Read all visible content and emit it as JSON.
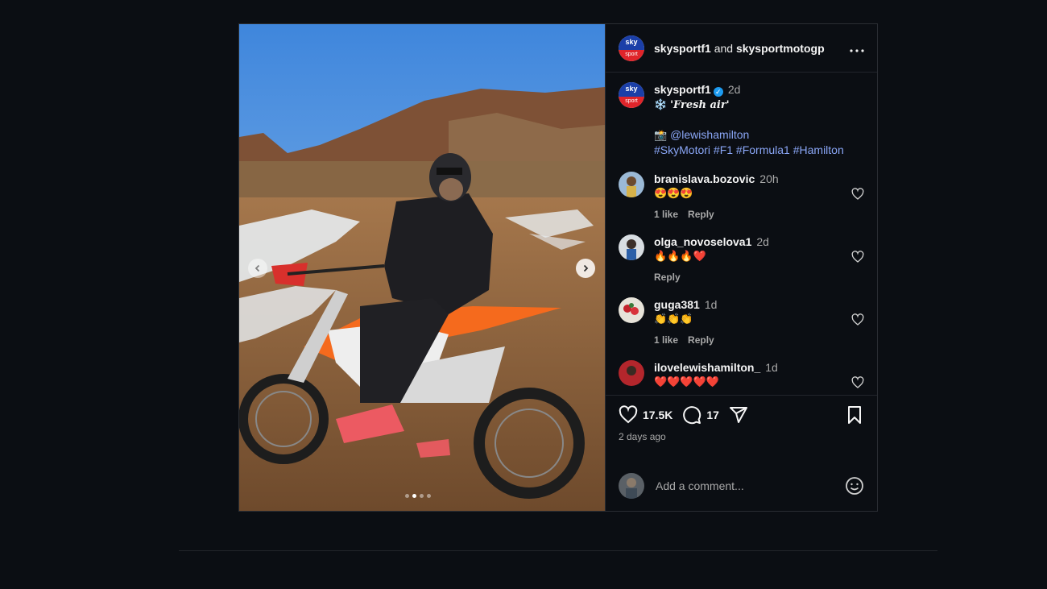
{
  "header": {
    "user1": "skysportf1",
    "and": "and",
    "user2": "skysportmotogp",
    "avatar_top": "sky",
    "avatar_bottom": "sport"
  },
  "caption": {
    "username": "skysportf1",
    "verified_mark": "✓",
    "time": "2d",
    "title_emoji": "❄️",
    "title": "'Fresh air'",
    "camera_emoji": "📸",
    "mention": "@lewishamilton",
    "hashtags": "#SkyMotori #F1 #Formula1 #Hamilton"
  },
  "comments": [
    {
      "username": "branislava.bozovic",
      "time": "20h",
      "text": "😍😍😍",
      "likes": "1 like",
      "reply": "Reply"
    },
    {
      "username": "olga_novoselova1",
      "time": "2d",
      "text": "🔥🔥🔥❤️",
      "likes": "",
      "reply": "Reply"
    },
    {
      "username": "guga381",
      "time": "1d",
      "text": "👏👏👏",
      "likes": "1 like",
      "reply": "Reply"
    },
    {
      "username": "ilovelewishamilton_",
      "time": "1d",
      "text": "❤️❤️❤️❤️❤️",
      "likes": "",
      "reply": ""
    }
  ],
  "actions": {
    "likes": "17.5K",
    "comments": "17",
    "posted": "2 days ago"
  },
  "add_comment": {
    "placeholder": "Add a comment..."
  },
  "colors": {
    "background": "#0b0e13",
    "link": "#8aa6f6",
    "verified": "#1d9bf0"
  }
}
